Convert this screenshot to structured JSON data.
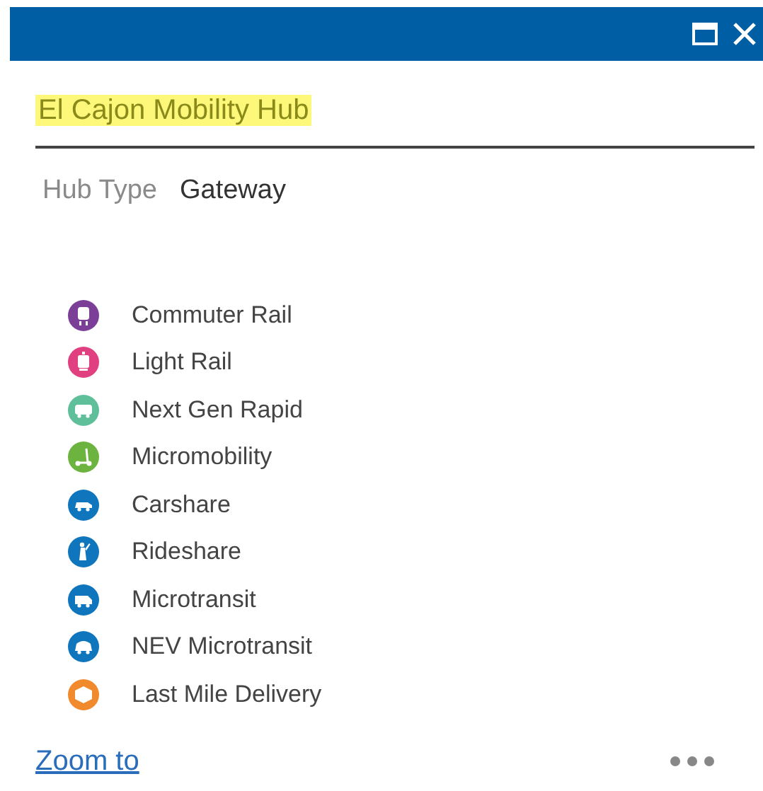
{
  "popup": {
    "title": "El Cajon Mobility Hub",
    "title_highlighted": true,
    "field": {
      "label": "Hub Type",
      "value": "Gateway"
    },
    "modes": [
      {
        "label": "Commuter Rail",
        "color": "#7b3f98",
        "kind": "train"
      },
      {
        "label": "Light Rail",
        "color": "#e0407f",
        "kind": "tram"
      },
      {
        "label": "Next Gen Rapid",
        "color": "#5fbf9a",
        "kind": "bus"
      },
      {
        "label": "Micromobility",
        "color": "#6cb33f",
        "kind": "scooter"
      },
      {
        "label": "Carshare",
        "color": "#0f75bc",
        "kind": "car"
      },
      {
        "label": "Rideshare",
        "color": "#0f75bc",
        "kind": "person"
      },
      {
        "label": "Microtransit",
        "color": "#0f75bc",
        "kind": "van"
      },
      {
        "label": "NEV Microtransit",
        "color": "#0f75bc",
        "kind": "cart"
      },
      {
        "label": "Last Mile Delivery",
        "color": "#f08a2c",
        "kind": "box"
      }
    ],
    "zoom_link": "Zoom to"
  }
}
